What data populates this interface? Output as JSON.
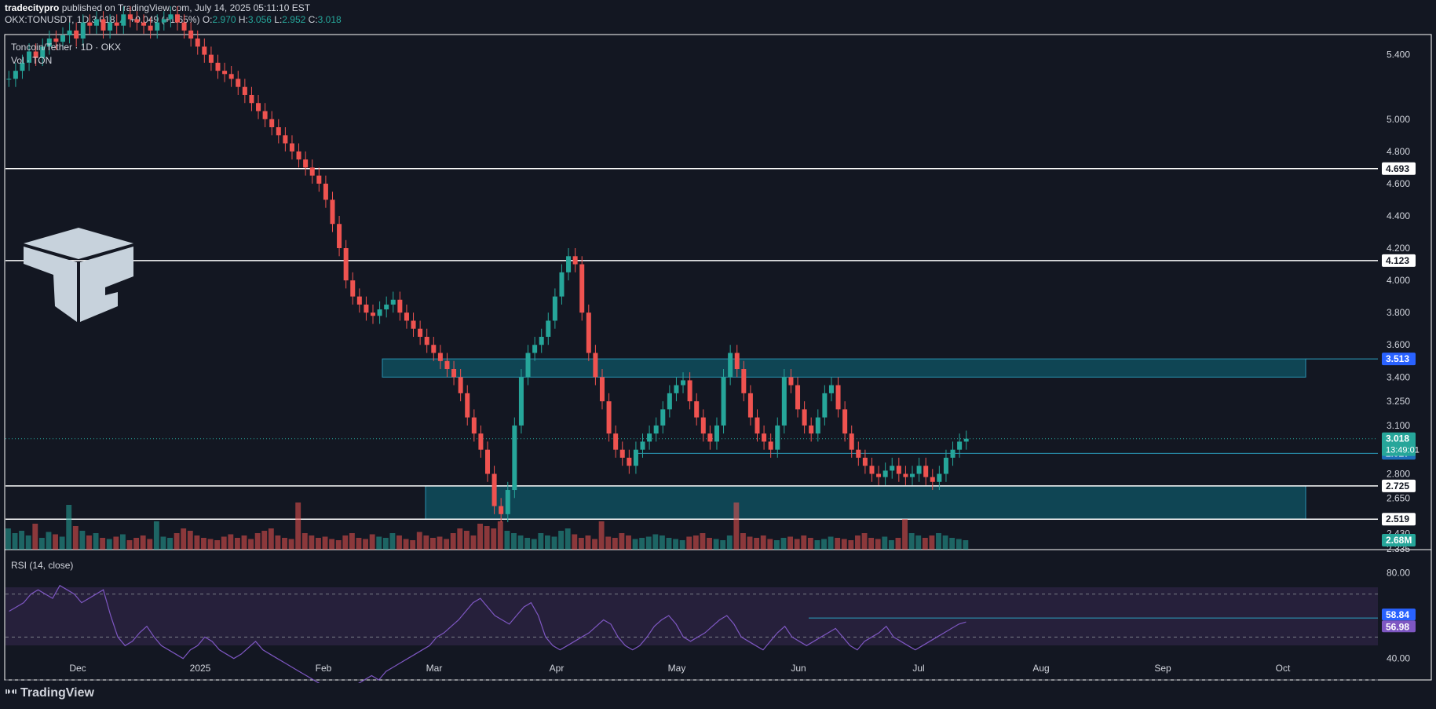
{
  "header": {
    "author": "tradecitypro",
    "published_text": " published on TradingView.com, July 14, 2025 05:11:10 EST",
    "symbol": "OKX:TONUSDT, 1D",
    "last": "3.018",
    "change": "+0.049 (+1.65%)",
    "open_label": "O:",
    "open": "2.970",
    "high_label": "H:",
    "high": "3.056",
    "low_label": "L:",
    "low": "2.952",
    "close_label": "C:",
    "close": "3.018"
  },
  "legend": {
    "title": "Toncoin/Tether · 1D · OKX",
    "volume": "Vol · TON"
  },
  "footer": {
    "brand": "TradingView"
  },
  "colors": {
    "background": "#131722",
    "up": "#26a69a",
    "down": "#ef5350",
    "zone_fill": "#0f4a5a",
    "zone_border": "#2b9fbf",
    "level_line": "#ffffff",
    "rsi_line": "#7e57c2",
    "rsi_band": "#2a2240",
    "price_label": "#26a69a"
  },
  "chart_data": [
    {
      "type": "candlestick",
      "title": "Toncoin/Tether · 1D · OKX",
      "ylim": [
        2.33,
        5.52
      ],
      "price_ticks": [
        "5.400",
        "5.000",
        "4.800",
        "4.600",
        "4.400",
        "4.200",
        "4.000",
        "3.800",
        "3.600",
        "3.400",
        "3.250",
        "3.100",
        "2.800",
        "2.650",
        "2.430",
        "2.335"
      ],
      "x_labels": [
        "Dec",
        "2025",
        "Feb",
        "Mar",
        "Apr",
        "May",
        "Jun",
        "Jul",
        "Aug",
        "Sep",
        "Oct"
      ],
      "horizontal_levels": [
        {
          "value": 4.693,
          "label": "4.693"
        },
        {
          "value": 4.123,
          "label": "4.123"
        },
        {
          "value": 2.725,
          "label": "2.725"
        },
        {
          "value": 2.519,
          "label": "2.519"
        }
      ],
      "zones": [
        {
          "from": 3.4,
          "to": 3.513,
          "label": "3.513"
        },
        {
          "from": 2.519,
          "to": 2.725
        }
      ],
      "trend_segment": {
        "value": 2.927,
        "label": "2.927"
      },
      "current_price": {
        "value": 3.018,
        "label": "3.018",
        "countdown": "13:49:01"
      },
      "volume_label": "2.68M",
      "close_series": [
        5.25,
        5.3,
        5.35,
        5.42,
        5.38,
        5.45,
        5.5,
        5.48,
        5.52,
        5.55,
        5.5,
        5.6,
        5.58,
        5.62,
        5.55,
        5.6,
        5.58,
        5.65,
        5.62,
        5.6,
        5.58,
        5.55,
        5.6,
        5.62,
        5.65,
        5.6,
        5.55,
        5.5,
        5.45,
        5.4,
        5.35,
        5.3,
        5.28,
        5.25,
        5.2,
        5.15,
        5.1,
        5.05,
        5.0,
        4.95,
        4.9,
        4.85,
        4.8,
        4.75,
        4.7,
        4.65,
        4.6,
        4.5,
        4.35,
        4.2,
        4.0,
        3.9,
        3.85,
        3.8,
        3.78,
        3.82,
        3.85,
        3.88,
        3.8,
        3.75,
        3.7,
        3.65,
        3.6,
        3.55,
        3.5,
        3.45,
        3.4,
        3.3,
        3.15,
        3.05,
        2.95,
        2.8,
        2.6,
        2.55,
        2.7,
        3.1,
        3.4,
        3.55,
        3.6,
        3.65,
        3.75,
        3.9,
        4.05,
        4.15,
        4.1,
        3.8,
        3.55,
        3.4,
        3.25,
        3.05,
        2.95,
        2.9,
        2.85,
        2.95,
        3.0,
        3.05,
        3.1,
        3.2,
        3.3,
        3.35,
        3.38,
        3.25,
        3.15,
        3.05,
        3.0,
        3.1,
        3.4,
        3.55,
        3.45,
        3.3,
        3.15,
        3.05,
        3.0,
        2.95,
        3.1,
        3.4,
        3.35,
        3.2,
        3.1,
        3.05,
        3.15,
        3.3,
        3.35,
        3.2,
        3.05,
        2.95,
        2.9,
        2.85,
        2.8,
        2.78,
        2.82,
        2.85,
        2.8,
        2.78,
        2.8,
        2.85,
        2.78,
        2.75,
        2.8,
        2.9,
        2.95,
        3.0,
        3.018
      ],
      "volume_series": [
        18,
        14,
        16,
        12,
        22,
        10,
        15,
        13,
        11,
        38,
        20,
        16,
        12,
        14,
        10,
        9,
        11,
        13,
        8,
        10,
        12,
        9,
        24,
        11,
        10,
        14,
        18,
        16,
        12,
        10,
        9,
        8,
        11,
        13,
        10,
        12,
        9,
        14,
        16,
        18,
        12,
        10,
        9,
        40,
        14,
        12,
        10,
        11,
        9,
        8,
        12,
        14,
        10,
        9,
        13,
        11,
        10,
        14,
        12,
        9,
        8,
        15,
        12,
        10,
        11,
        9,
        14,
        18,
        16,
        12,
        22,
        20,
        18,
        24,
        16,
        14,
        12,
        10,
        9,
        14,
        12,
        11,
        16,
        18,
        13,
        10,
        12,
        9,
        24,
        11,
        10,
        14,
        12,
        9,
        10,
        11,
        13,
        12,
        10,
        9,
        8,
        11,
        12,
        14,
        10,
        9,
        8,
        12,
        40,
        14,
        11,
        10,
        12,
        9,
        8,
        10,
        11,
        9,
        12,
        10,
        8,
        9,
        11,
        10,
        9,
        8,
        12,
        14,
        10,
        9,
        11,
        8,
        10,
        26,
        14,
        12,
        10,
        12,
        14,
        12,
        10,
        9,
        8
      ],
      "rsi": {
        "title": "RSI (14, close)",
        "ylim": [
          30,
          90
        ],
        "ticks": [
          "80.00",
          "40.00"
        ],
        "bands": [
          70,
          50,
          30
        ],
        "values": [
          62,
          64,
          66,
          70,
          72,
          70,
          68,
          74,
          72,
          70,
          66,
          68,
          70,
          72,
          60,
          50,
          46,
          48,
          52,
          55,
          50,
          46,
          44,
          42,
          40,
          44,
          46,
          50,
          48,
          44,
          42,
          40,
          42,
          45,
          48,
          44,
          42,
          40,
          38,
          36,
          34,
          32,
          30,
          28,
          26,
          24,
          24,
          26,
          28,
          30,
          32,
          30,
          34,
          36,
          38,
          40,
          42,
          44,
          46,
          50,
          52,
          55,
          58,
          62,
          66,
          68,
          64,
          60,
          58,
          56,
          60,
          64,
          66,
          60,
          50,
          46,
          44,
          46,
          48,
          50,
          52,
          55,
          58,
          56,
          50,
          46,
          44,
          46,
          50,
          55,
          58,
          60,
          56,
          50,
          48,
          50,
          52,
          55,
          58,
          60,
          56,
          50,
          48,
          46,
          44,
          48,
          52,
          55,
          50,
          48,
          46,
          48,
          50,
          52,
          54,
          50,
          46,
          44,
          48,
          50,
          52,
          55,
          50,
          48,
          46,
          44,
          46,
          48,
          50,
          52,
          54,
          56,
          57
        ],
        "last_values": [
          {
            "value": 58.84,
            "label": "58.84"
          },
          {
            "value": 56.98,
            "label": "56.98"
          }
        ]
      }
    }
  ]
}
